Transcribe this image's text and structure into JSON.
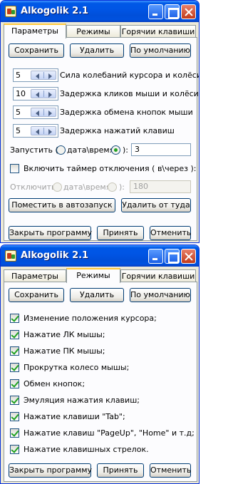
{
  "window": {
    "title": "Alkogolik 2.1"
  },
  "tabs": [
    "Параметры",
    "Режимы",
    "Горячии клавиши"
  ],
  "panel1": {
    "buttons": {
      "save": "Сохранить",
      "delete": "Удалить",
      "default": "По умолчанию"
    },
    "spinners": [
      {
        "value": "5",
        "label": "Сила колебаний курсора и колёсика"
      },
      {
        "value": "10",
        "label": "Задержка кликов мыши и колёсика"
      },
      {
        "value": "5",
        "label": "Задержка обмена кнопок мыши"
      },
      {
        "value": "5",
        "label": "Задержка нажатий клавиш"
      }
    ],
    "launch": {
      "prefix": "Запустить (",
      "option_a": "дата\\время",
      "suffix": "):",
      "value": "3"
    },
    "timer": {
      "label": "Включить таймер отключения ( в\\через ):",
      "checked": false
    },
    "disable": {
      "prefix": "Отключить (",
      "option_a": "дата\\время",
      "suffix": "):",
      "value": "180"
    },
    "autostart": {
      "add": "Поместить в автозапуск",
      "remove": "Удалить от туда"
    }
  },
  "panel2": {
    "buttons": {
      "save": "Сохранить",
      "delete": "Удалить",
      "default": "По умолчанию"
    },
    "modes": [
      "Изменение положения курсора;",
      "Нажатие ЛК мышы;",
      "Нажатие ПК мышы;",
      "Прокрутка колесо мышы;",
      "Обмен кнопок;",
      "Эмуляция нажатия клавиш;",
      "Нажатие клавиши \"Tab\";",
      "Нажатие клавиш \"PageUp\", \"Home\" и т.д;",
      "Нажатие клавишных стрелок."
    ]
  },
  "footer": {
    "close": "Закрыть программу",
    "apply": "Принять",
    "cancel": "Отменить"
  }
}
